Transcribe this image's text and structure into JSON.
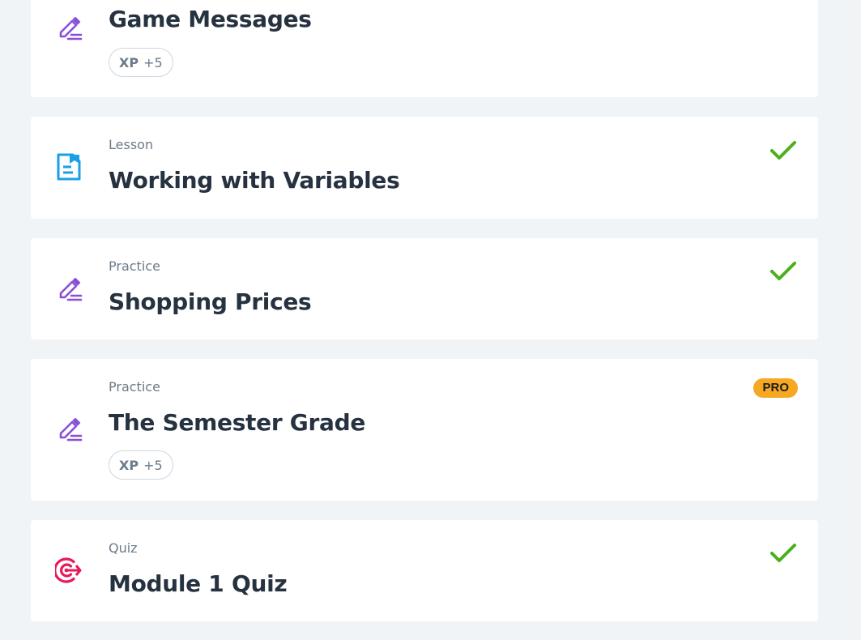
{
  "items": [
    {
      "kind": "",
      "title": "Game Messages",
      "icon": "pencil-icon",
      "xp": {
        "label": "XP",
        "value": "+5"
      },
      "completed": false,
      "pro": false
    },
    {
      "kind": "Lesson",
      "title": "Working with Variables",
      "icon": "document-icon",
      "completed": true,
      "pro": false
    },
    {
      "kind": "Practice",
      "title": "Shopping Prices",
      "icon": "pencil-icon",
      "completed": true,
      "pro": false
    },
    {
      "kind": "Practice",
      "title": "The Semester Grade",
      "icon": "pencil-icon",
      "xp": {
        "label": "XP",
        "value": "+5"
      },
      "completed": false,
      "pro": true,
      "pro_label": "PRO"
    },
    {
      "kind": "Quiz",
      "title": "Module 1 Quiz",
      "icon": "target-icon",
      "completed": true,
      "pro": false
    }
  ],
  "colors": {
    "background": "#f1f4f7",
    "card": "#ffffff",
    "practice_icon": "#8a4fd8",
    "lesson_icon": "#1aa0e6",
    "quiz_icon": "#e6195a",
    "check": "#4caf1c",
    "pro_badge": "#f7a823"
  }
}
